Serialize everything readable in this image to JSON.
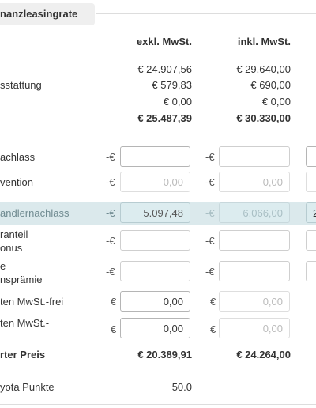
{
  "section": {
    "title": "nanzleasingrate"
  },
  "columns": {
    "excl": "exkl. MwSt.",
    "incl": "inkl. MwSt."
  },
  "price_rows": [
    {
      "label": "",
      "excl": "€ 24.907,56",
      "incl": "€ 29.640,00"
    },
    {
      "label": "sstattung",
      "excl": "€ 579,83",
      "incl": "€ 690,00"
    },
    {
      "label": "",
      "excl": "€ 0,00",
      "incl": "€ 0,00"
    },
    {
      "label": "",
      "excl": "€ 25.487,39",
      "incl": "€ 30.330,00"
    }
  ],
  "input_rows": [
    {
      "label_lines": [
        "achlass"
      ],
      "prefix1": "-€",
      "value1": "",
      "prefix2": "-€",
      "value2": "",
      "value3": ""
    },
    {
      "label_lines": [
        "vention"
      ],
      "prefix1": "-€",
      "value1": "0,00",
      "prefix2": "-€",
      "value2": "0,00",
      "value3": ""
    },
    {
      "label_lines": [
        "ändlernachlass"
      ],
      "prefix1": "-€",
      "value1": "5.097,48",
      "prefix2": "-€",
      "value2": "6.066,00",
      "value3": "2"
    },
    {
      "label_lines": [
        "ranteil",
        "onus"
      ],
      "prefix1": "-€",
      "value1": "",
      "prefix2": "-€",
      "value2": "",
      "value3": ""
    },
    {
      "label_lines": [
        "e",
        "nsprämie"
      ],
      "prefix1": "-€",
      "value1": "",
      "prefix2": "-€",
      "value2": "",
      "value3": ""
    },
    {
      "label_lines": [
        "ten MwSt.-frei"
      ],
      "prefix1": "€",
      "value1": "0,00",
      "prefix2": "€",
      "value2": "0,00",
      "value3": ""
    },
    {
      "label_lines": [
        "ten MwSt.-"
      ],
      "prefix1": "€",
      "value1": "0,00",
      "prefix2": "€",
      "value2": "0,00",
      "value3": ""
    }
  ],
  "total": {
    "label": "rter Preis",
    "excl": "€ 20.389,91",
    "incl": "€ 24.264,00"
  },
  "points": {
    "label": "yota Punkte",
    "value": "50.0"
  },
  "colors": {
    "highlight_band": "#dbe9ec",
    "tab_bg": "#efefef"
  }
}
